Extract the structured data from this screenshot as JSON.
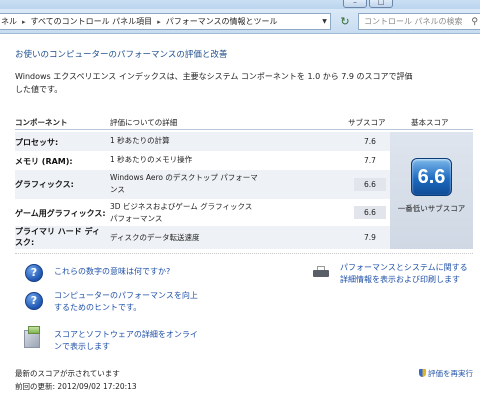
{
  "window": {
    "minimize_glyph": "–",
    "maximize_glyph": "□"
  },
  "address": {
    "crumbs": [
      "ネル",
      "すべてのコントロール パネル項目",
      "パフォーマンスの情報とツール"
    ],
    "search_placeholder": "コントロール パネルの検索"
  },
  "page": {
    "heading": "お使いのコンピューターのパフォーマンスの評価と改善",
    "description": "Windows エクスペリエンス インデックスは、主要なシステム コンポーネントを 1.0 から 7.9 のスコアで評価した値です。"
  },
  "table": {
    "headers": {
      "component": "コンポーネント",
      "details": "評価についての詳細",
      "subscore": "サブスコア",
      "basescore": "基本スコア"
    },
    "rows": [
      {
        "name": "プロセッサ:",
        "detail": "1 秒あたりの計算",
        "score": "7.6"
      },
      {
        "name": "メモリ (RAM):",
        "detail": "1 秒あたりのメモリ操作",
        "score": "7.7"
      },
      {
        "name": "グラフィックス:",
        "detail": "Windows Aero のデスクトップ パフォーマンス",
        "score": "6.6"
      },
      {
        "name": "ゲーム用グラフィックス:",
        "detail": "3D ビジネスおよびゲーム グラフィックス パフォーマンス",
        "score": "6.6"
      },
      {
        "name": "プライマリ ハード ディスク:",
        "detail": "ディスクのデータ転送速度",
        "score": "7.9"
      }
    ],
    "base_score": "6.6",
    "base_caption": "一番低いサブスコア"
  },
  "links": {
    "meaning": "これらの数字の意味は何ですか?",
    "tips": "コンピューターのパフォーマンスを向上するためのヒントです。",
    "online": "スコアとソフトウェアの詳細をオンラインで表示します",
    "print": "パフォーマンスとシステムに関する詳細情報を表示および印刷します"
  },
  "footer": {
    "status": "最新のスコアが示されています",
    "last_update": "前回の更新: 2012/09/02 17:20:13",
    "rerun": "評価を再実行"
  },
  "colors": {
    "link": "#1f50a8",
    "heading": "#1f4f8f",
    "badge": "#1d6ac0"
  }
}
